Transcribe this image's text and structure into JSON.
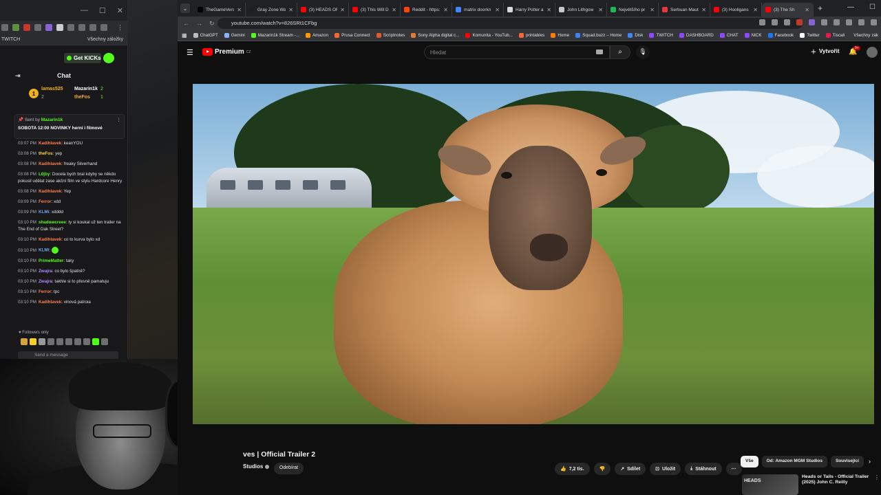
{
  "chat_window": {
    "bookmarks_left": "TWITCH",
    "bookmarks_right": "Všechny záložky",
    "kick_button": "Get KICKs",
    "chat_title": "Chat",
    "leaderboard": [
      {
        "name": "lamas525",
        "count": "2"
      },
      {
        "name": "Mazarin1k",
        "count": "2"
      },
      {
        "name": "theFos",
        "count": "1"
      }
    ],
    "leaderboard_rank": "1",
    "pinned": {
      "sent_by": "Sent by",
      "sender": "Mazarin1k",
      "message": "SOBOTA 12:00 NOVINKY herní i filmové"
    },
    "messages": [
      {
        "time": "03:07 PM",
        "user": "Kadihlavek",
        "color": "#ff7f50",
        "text": "keanYOU"
      },
      {
        "time": "03:08 PM",
        "user": "theFos",
        "color": "#ffd23f",
        "text": "yep"
      },
      {
        "time": "03:08 PM",
        "user": "Kadihlavek",
        "color": "#ff7f50",
        "text": "freaky Silverhand"
      },
      {
        "time": "03:08 PM",
        "user": "L0jby",
        "color": "#53fc18",
        "text": "Docela bych bral kdyby se někdo pokusil udělat zase akční film ve stylu Hardcore Henry"
      },
      {
        "time": "03:08 PM",
        "user": "Kadihlavek",
        "color": "#ff7f50",
        "text": "Yep"
      },
      {
        "time": "03:09 PM",
        "user": "Ferror",
        "color": "#ff7f50",
        "text": "xdd"
      },
      {
        "time": "03:09 PM",
        "user": "KLMi",
        "color": "#6ea8ff",
        "text": "xdddd"
      },
      {
        "time": "03:10 PM",
        "user": "shadowcreee",
        "color": "#53fc18",
        "text": "ty si koukal už ten trailer na The End of Oak Street?"
      },
      {
        "time": "03:10 PM",
        "user": "Kadihlavek",
        "color": "#ff7f50",
        "text": "co to kurva bylo xd"
      },
      {
        "time": "03:10 PM",
        "user": "KLMi",
        "color": "#6ea8ff",
        "text": ""
      },
      {
        "time": "03:10 PM",
        "user": "PrimeMatter",
        "color": "#53fc18",
        "text": "taky"
      },
      {
        "time": "03:10 PM",
        "user": "Zwajra",
        "color": "#b28dff",
        "text": "co bylo špatně?"
      },
      {
        "time": "03:10 PM",
        "user": "Zwajra",
        "color": "#b28dff",
        "text": "takhle si to přesně pamatuju"
      },
      {
        "time": "03:10 PM",
        "user": "Ferror",
        "color": "#ff7f50",
        "text": "tpc"
      },
      {
        "time": "03:10 PM",
        "user": "Kadihlavek",
        "color": "#ff7f50",
        "text": "vinová patroia"
      }
    ],
    "followers_only": "Followers only",
    "send_placeholder": "Send a message"
  },
  "browser": {
    "tabs": [
      {
        "title": "TheGameVerse",
        "color": "#000000"
      },
      {
        "title": "Gray Zone Wa",
        "color": "#1f1f1f"
      },
      {
        "title": "(3) HEADS OR",
        "color": "#ff0000"
      },
      {
        "title": "(3) This Will D",
        "color": "#ff0000"
      },
      {
        "title": "Reddit - https:",
        "color": "#ff4500"
      },
      {
        "title": "matrix doorkn",
        "color": "#4285f4"
      },
      {
        "title": "Harry Potter a",
        "color": "#d9d9d9"
      },
      {
        "title": "John Lithgow",
        "color": "#c8c8c8"
      },
      {
        "title": "Největšího pr",
        "color": "#1db954"
      },
      {
        "title": "Serbuan Maut",
        "color": "#e5383b"
      },
      {
        "title": "(3) Hooligans",
        "color": "#ff0000"
      },
      {
        "title": "(3) The Sh",
        "color": "#ff0000"
      }
    ],
    "url": "youtube.com/watch?v=826SRt1CFbg",
    "bookmarks": [
      {
        "label": "ChatGPT",
        "color": "#bbbbbb"
      },
      {
        "label": "Gemini",
        "color": "#8ab4f8"
      },
      {
        "label": "Mazarin1k Stream -...",
        "color": "#53fc18"
      },
      {
        "label": "Amazon",
        "color": "#ff9900"
      },
      {
        "label": "Prusa Connect",
        "color": "#fa6831"
      },
      {
        "label": "Scriptnotes",
        "color": "#e05a2b"
      },
      {
        "label": "Sony Alpha digital c...",
        "color": "#e07b39"
      },
      {
        "label": "Komunita - YouTub...",
        "color": "#ff0000"
      },
      {
        "label": "printables",
        "color": "#fa6831"
      },
      {
        "label": "Home",
        "color": "#ff7a00"
      },
      {
        "label": "Squad.buzz – Home",
        "color": "#3b82f6"
      },
      {
        "label": "Disk",
        "color": "#4285f4"
      },
      {
        "label": "TWITCH",
        "color": "#9146ff"
      },
      {
        "label": "DASHBOARD",
        "color": "#9146ff"
      },
      {
        "label": "CHAT",
        "color": "#9146ff"
      },
      {
        "label": "NICK",
        "color": "#9146ff"
      },
      {
        "label": "Facebook",
        "color": "#1877f2"
      },
      {
        "label": "Twitter",
        "color": "#ffffff"
      },
      {
        "label": "Tiscali",
        "color": "#e11d48"
      }
    ],
    "bookmarks_right": "Všechny zák"
  },
  "youtube": {
    "logo_text": "Premium",
    "logo_sup": "CZ",
    "search_placeholder": "Hledat",
    "create_label": "Vytvořit",
    "notification_count": "9+",
    "video_title": "ves | Official Trailer 2",
    "channel_name": "Studios",
    "subscribe_label": "Odebírat",
    "likes": "7,2 tis.",
    "share_label": "Sdílet",
    "save_label": "Uložit",
    "download_label": "Stáhnout",
    "chips": [
      {
        "label": "Vše",
        "active": true
      },
      {
        "label": "Od: Amazon MGM Studios",
        "active": false
      },
      {
        "label": "Související",
        "active": false
      }
    ],
    "recommendation": {
      "thumb_text": "HEADS",
      "title": "Heads or Tails - Official Trailer (2025) John C. Reilly"
    }
  }
}
